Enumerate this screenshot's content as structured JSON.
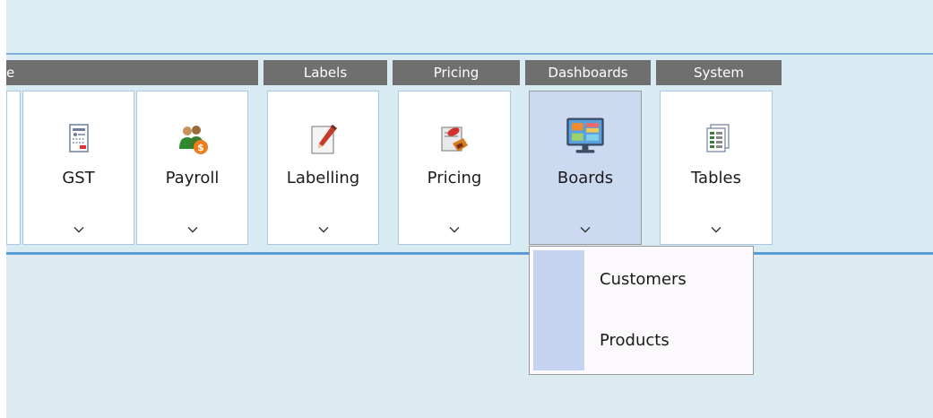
{
  "ribbon": {
    "groups": [
      {
        "label": "e"
      },
      {
        "label": "Labels"
      },
      {
        "label": "Pricing"
      },
      {
        "label": "Dashboards"
      },
      {
        "label": "System"
      }
    ],
    "buttons": [
      {
        "label": "GST",
        "icon": "gst-document-icon"
      },
      {
        "label": "Payroll",
        "icon": "payroll-people-icon"
      },
      {
        "label": "Labelling",
        "icon": "labelling-pencil-icon"
      },
      {
        "label": "Pricing",
        "icon": "pricing-tag-icon"
      },
      {
        "label": "Boards",
        "icon": "boards-monitor-icon",
        "active": true
      },
      {
        "label": "Tables",
        "icon": "tables-sheets-icon"
      }
    ]
  },
  "boards_menu": {
    "items": [
      {
        "label": "Customers"
      },
      {
        "label": "Products"
      }
    ]
  },
  "colors": {
    "group_header_bg": "#6f6f6f",
    "active_button_bg": "#cbd9f1",
    "ribbon_line": "#5b9bd5",
    "menu_gutter": "#c5d5f1"
  }
}
